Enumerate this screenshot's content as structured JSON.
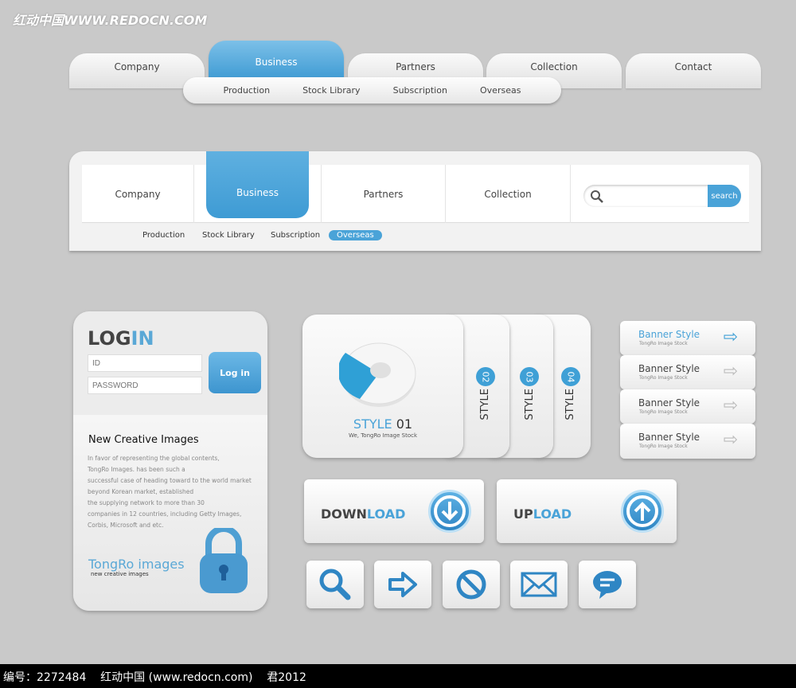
{
  "watermark": "红动中国WWW.REDOCN.COM",
  "nav1": {
    "tabs": [
      "Company",
      "Business",
      "Partners",
      "Collection",
      "Contact"
    ],
    "active": "Business",
    "sub": [
      "Production",
      "Stock Library",
      "Subscription",
      "Overseas"
    ]
  },
  "nav2": {
    "tabs": [
      "Company",
      "Business",
      "Partners",
      "Collection"
    ],
    "active": "Business",
    "search_label": "search",
    "search_placeholder": "",
    "sub": [
      "Production",
      "Stock Library",
      "Subscription",
      "Overseas"
    ],
    "sub_active": "Overseas"
  },
  "login": {
    "title_a": "LOG",
    "title_b": "IN",
    "id_placeholder": "ID",
    "password_placeholder": "PASSWORD",
    "button": "Log in",
    "heading": "New Creative Images",
    "body": [
      "In favor of representing the global contents,",
      "TongRo Images. has been such a",
      "successful case of heading toward to the world market",
      "beyond Korean market, established",
      "the supplying network to more than 30",
      "companies in 12 countries, including Getty Images,",
      "Corbis, Microsoft and etc."
    ],
    "brand": "TongRo images",
    "brand_sub": "new creative images"
  },
  "styles": {
    "main_a": "STYLE",
    "main_b": "01",
    "main_sub": "We, TongRo Image Stock",
    "tabs": [
      {
        "label": "STYLE",
        "num": "02"
      },
      {
        "label": "STYLE",
        "num": "03"
      },
      {
        "label": "STYLE",
        "num": "04"
      }
    ]
  },
  "banners": [
    {
      "title": "Banner Style",
      "sub": "TongRo Image Stock"
    },
    {
      "title": "Banner Style",
      "sub": "TongRo Image Stock"
    },
    {
      "title": "Banner Style",
      "sub": "TongRo Image Stock"
    },
    {
      "title": "Banner Style",
      "sub": "TongRo Image Stock"
    }
  ],
  "download": {
    "a": "DOWN",
    "b": "LOAD"
  },
  "upload": {
    "a": "UP",
    "b": "LOAD"
  },
  "icons": [
    "search-icon",
    "arrow-right-icon",
    "prohibited-icon",
    "mail-icon",
    "chat-icon"
  ],
  "colors": {
    "accent": "#4aa3d8",
    "background": "#c9c9c9"
  },
  "footer": "编号：2272484    红动中国 (www.redocn.com)    君2012"
}
